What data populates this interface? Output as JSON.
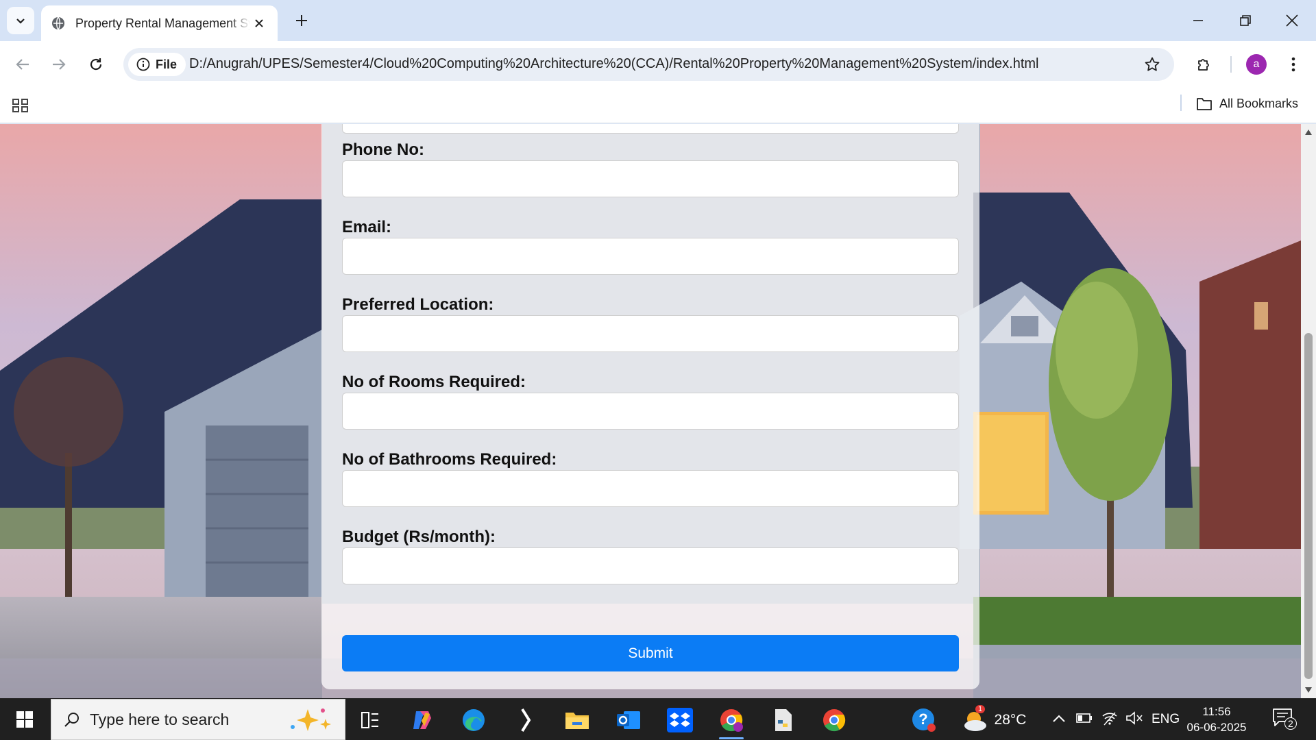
{
  "browser": {
    "tab": {
      "title": "Property Rental Management System"
    },
    "address": {
      "chip_label": "File",
      "url": "D:/Anugrah/UPES/Semester4/Cloud%20Computing%20Architecture%20(CCA)/Rental%20Property%20Management%20System/index.html"
    },
    "profile_initial": "a",
    "bookmarks": {
      "all_bookmarks_label": "All Bookmarks"
    }
  },
  "page": {
    "form": {
      "fields": [
        {
          "label": "Phone No:"
        },
        {
          "label": "Email:"
        },
        {
          "label": "Preferred Location:"
        },
        {
          "label": "No of Rooms Required:"
        },
        {
          "label": "No of Bathrooms Required:"
        },
        {
          "label": "Budget (Rs/month):"
        }
      ],
      "submit_label": "Submit"
    }
  },
  "taskbar": {
    "search_placeholder": "Type here to search",
    "weather": "28°C",
    "language": "ENG",
    "time": "11:56",
    "date": "06-06-2025",
    "weather_badge": "1",
    "notifications_count": "2"
  },
  "colors": {
    "submit_button": "#0b7cf5",
    "tab_strip": "#d6e3f6",
    "taskbar": "#202020",
    "avatar": "#9c27b0"
  }
}
